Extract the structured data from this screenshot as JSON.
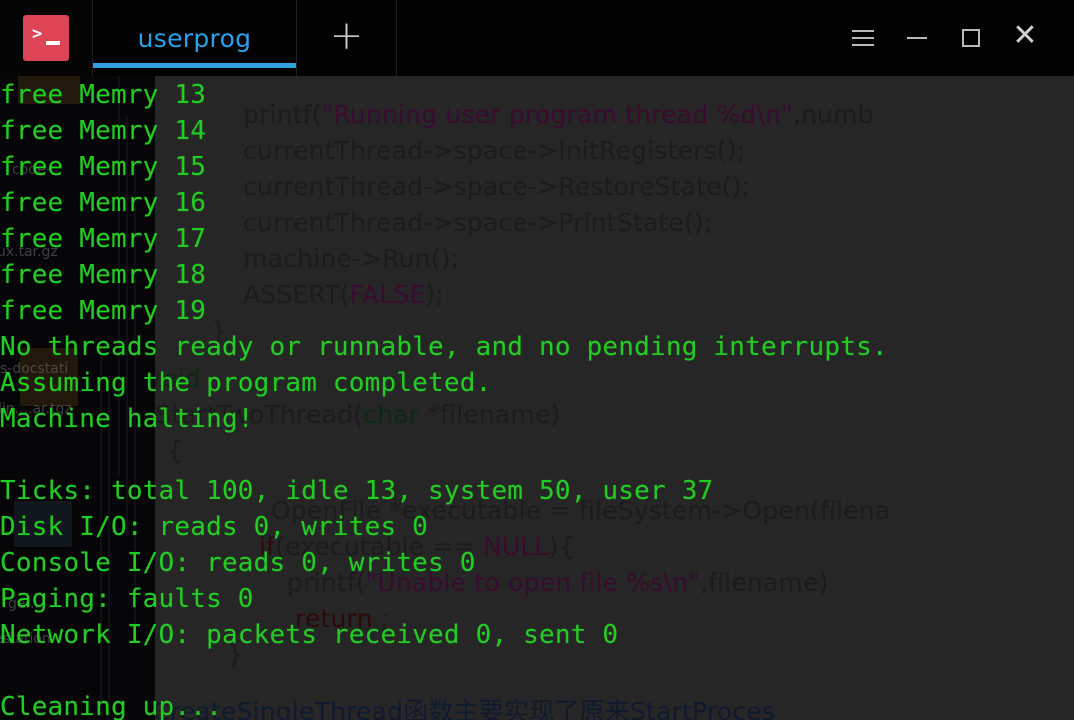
{
  "window": {
    "app_icon": "terminal-icon",
    "tabs": [
      {
        "label": "userprog",
        "active": true
      }
    ],
    "new_tab_label": "+",
    "controls": {
      "menu": "hamburger-menu",
      "minimize": "minimize",
      "maximize": "maximize",
      "close": "close"
    },
    "accent_color": "#2f9fe0",
    "tab_text_color": "#29a0e8",
    "icon_color": "#dd4455"
  },
  "terminal": {
    "text_color": "#22cc22",
    "background_color": "#242424",
    "lines": [
      "free Memry 13",
      "free Memry 14",
      "free Memry 15",
      "free Memry 16",
      "free Memry 17",
      "free Memry 18",
      "free Memry 19",
      "No threads ready or runnable, and no pending interrupts.",
      "Assuming the program completed.",
      "Machine halting!",
      "",
      "Ticks: total 100, idle 13, system 50, user 37",
      "Disk I/O: reads 0, writes 0",
      "Console I/O: reads 0, writes 0",
      "Paging: faults 0",
      "Network I/O: packets received 0, sent 0",
      "",
      "Cleaning up..."
    ]
  },
  "background_editor": {
    "lines": [
      {
        "segments": [
          {
            "t": "printf(",
            "c": "plain"
          },
          {
            "t": "\"Running user program thread %d\\n\"",
            "c": "str"
          },
          {
            "t": ",numb",
            "c": "plain"
          }
        ]
      },
      {
        "segments": [
          {
            "t": "currentThread->space->InitRegisters();",
            "c": "plain"
          }
        ]
      },
      {
        "segments": [
          {
            "t": "currentThread->space->RestoreState();",
            "c": "plain"
          }
        ]
      },
      {
        "segments": [
          {
            "t": "currentThread->space->PrintState();",
            "c": "plain"
          }
        ]
      },
      {
        "segments": [
          {
            "t": "machine->Run();",
            "c": "plain"
          }
        ]
      },
      {
        "segments": [
          {
            "t": "ASSERT(",
            "c": "plain"
          },
          {
            "t": "FALSE",
            "c": "str"
          },
          {
            "t": ");",
            "c": "plain"
          }
        ]
      },
      {
        "segments": [
          {
            "t": "}",
            "c": "plain"
          }
        ]
      },
      {
        "segments": [
          {
            "t": "void",
            "c": "kw"
          }
        ]
      },
      {
        "segments": [
          {
            "t": "StartTwoThread(",
            "c": "plain"
          },
          {
            "t": "char",
            "c": "kw"
          },
          {
            "t": " *filename)",
            "c": "plain"
          }
        ]
      },
      {
        "segments": [
          {
            "t": "{",
            "c": "plain"
          }
        ]
      },
      {
        "segments": [
          {
            "t": "OpenFile *executable = fileSystem->Open(filena",
            "c": "plain"
          }
        ]
      },
      {
        "segments": [
          {
            "t": "if",
            "c": "kw2"
          },
          {
            "t": "(executable == ",
            "c": "plain"
          },
          {
            "t": "NULL",
            "c": "str"
          },
          {
            "t": "){",
            "c": "plain"
          }
        ]
      },
      {
        "segments": [
          {
            "t": "printf(",
            "c": "plain"
          },
          {
            "t": "\"Unable to open file %s\\n\"",
            "c": "str"
          },
          {
            "t": ",filename)",
            "c": "plain"
          }
        ]
      },
      {
        "segments": [
          {
            "t": "return",
            "c": "kw2"
          },
          {
            "t": " ;",
            "c": "plain"
          }
        ]
      },
      {
        "segments": [
          {
            "t": "}",
            "c": "plain"
          }
        ]
      },
      {
        "segments": [
          {
            "t": "//CreateSingleThread函数主要实现了原来StartProces",
            "c": "cn"
          }
        ]
      }
    ]
  },
  "desktop_icons": [
    {
      "label": "code-"
    },
    {
      "label": "nux.tar.gz"
    },
    {
      "label": "s-docstati"
    },
    {
      "label": "lin....ar.tgz"
    },
    {
      "label": "ge..."
    },
    {
      "label": "estation"
    }
  ]
}
